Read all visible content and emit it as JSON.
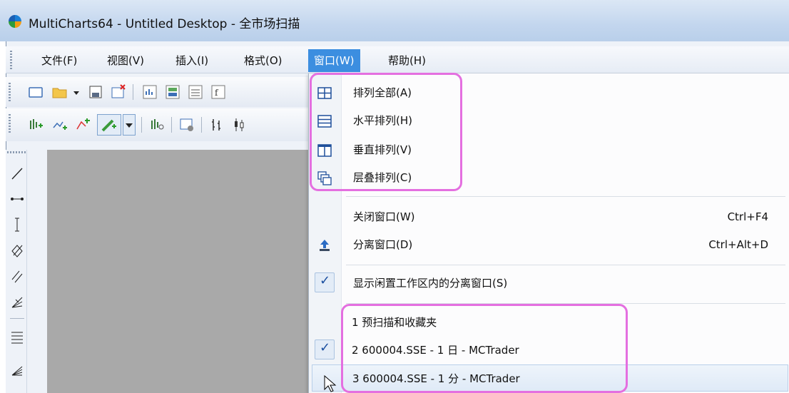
{
  "window": {
    "title": "MultiCharts64 - Untitled Desktop - 全市场扫描"
  },
  "menubar": {
    "items": [
      {
        "label": "文件(F)"
      },
      {
        "label": "视图(V)"
      },
      {
        "label": "插入(I)"
      },
      {
        "label": "格式(O)"
      },
      {
        "label": "窗口(W)"
      },
      {
        "label": "帮助(H)"
      }
    ]
  },
  "window_menu": {
    "arrange": [
      {
        "label": "排列全部(A)",
        "icon": "tile-all-icon"
      },
      {
        "label": "水平排列(H)",
        "icon": "tile-horizontal-icon"
      },
      {
        "label": "垂直排列(V)",
        "icon": "tile-vertical-icon"
      },
      {
        "label": "层叠排列(C)",
        "icon": "cascade-icon"
      }
    ],
    "close_window": {
      "label": "关闭窗口(W)",
      "shortcut": "Ctrl+F4"
    },
    "detach_window": {
      "label": "分离窗口(D)",
      "shortcut": "Ctrl+Alt+D",
      "icon": "detach-icon"
    },
    "show_idle": {
      "label": "显示闲置工作区内的分离窗口(S)",
      "checked": true
    },
    "windows": [
      {
        "label": "1 预扫描和收藏夹",
        "checked": false
      },
      {
        "label": "2 600004.SSE - 1 日 - MCTrader",
        "checked": true
      },
      {
        "label": "3 600004.SSE - 1 分 - MCTrader",
        "checked": false
      }
    ]
  },
  "colors": {
    "menu_active": "#3c8ee0",
    "highlight_border": "#e46fe0",
    "workspace": "#a9a9a9"
  }
}
